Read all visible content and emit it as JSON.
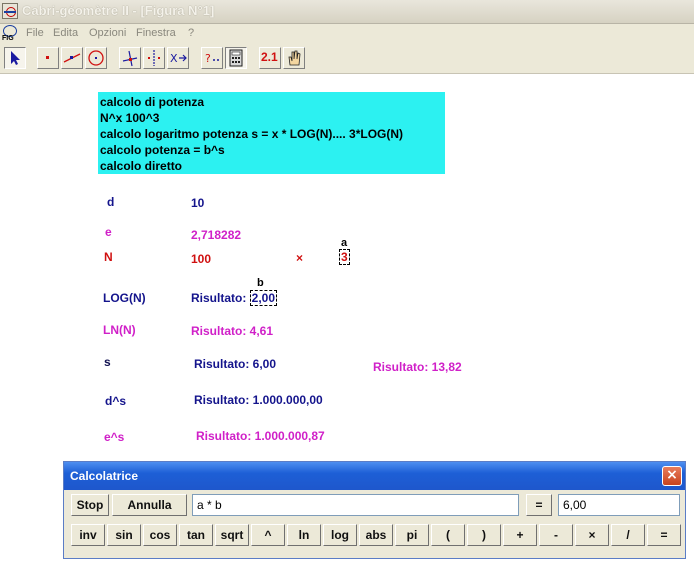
{
  "window": {
    "title": "Cabri-géomètre II - [Figura N°1]"
  },
  "menu": {
    "items": [
      "File",
      "Edita",
      "Opzioni",
      "Finestra",
      "?"
    ]
  },
  "toolbar": {
    "calc_label": "2.1"
  },
  "info": {
    "lines": [
      "calcolo di potenza",
      "N^x   100^3",
      "calcolo logaritmo potenza s = x * LOG(N).... 3*LOG(N)",
      "calcolo potenza = b^s",
      "calcolo diretto"
    ]
  },
  "canvas": {
    "d_label": "d",
    "d_value": "10",
    "e_label": "e",
    "e_value": "2,718282",
    "n_label": "N",
    "n_value": "100",
    "times": "×",
    "a_label": "a",
    "a_value": "3",
    "b_label": "b",
    "log_label": "LOG(N)",
    "log_prefix": "Risultato: ",
    "log_value": "2,00",
    "ln_label": "LN(N)",
    "ln_result": "Risultato: 4,61",
    "s_label": "s",
    "s_result": "Risultato: 6,00",
    "s_result2": "Risultato: 13,82",
    "ds_label": "d^s",
    "ds_result": "Risultato: 1.000.000,00",
    "es_label": "e^s",
    "es_result": "Risultato: 1.000.000,87"
  },
  "calculator": {
    "title": "Calcolatrice",
    "close": "×",
    "stop": "Stop",
    "annulla": "Annulla",
    "expression": "a * b",
    "equals": "=",
    "result": "6,00",
    "keys": [
      "inv",
      "sin",
      "cos",
      "tan",
      "sqrt",
      "^",
      "ln",
      "log",
      "abs",
      "pi",
      "(",
      ")",
      "+",
      "-",
      "×",
      "/",
      "="
    ]
  }
}
